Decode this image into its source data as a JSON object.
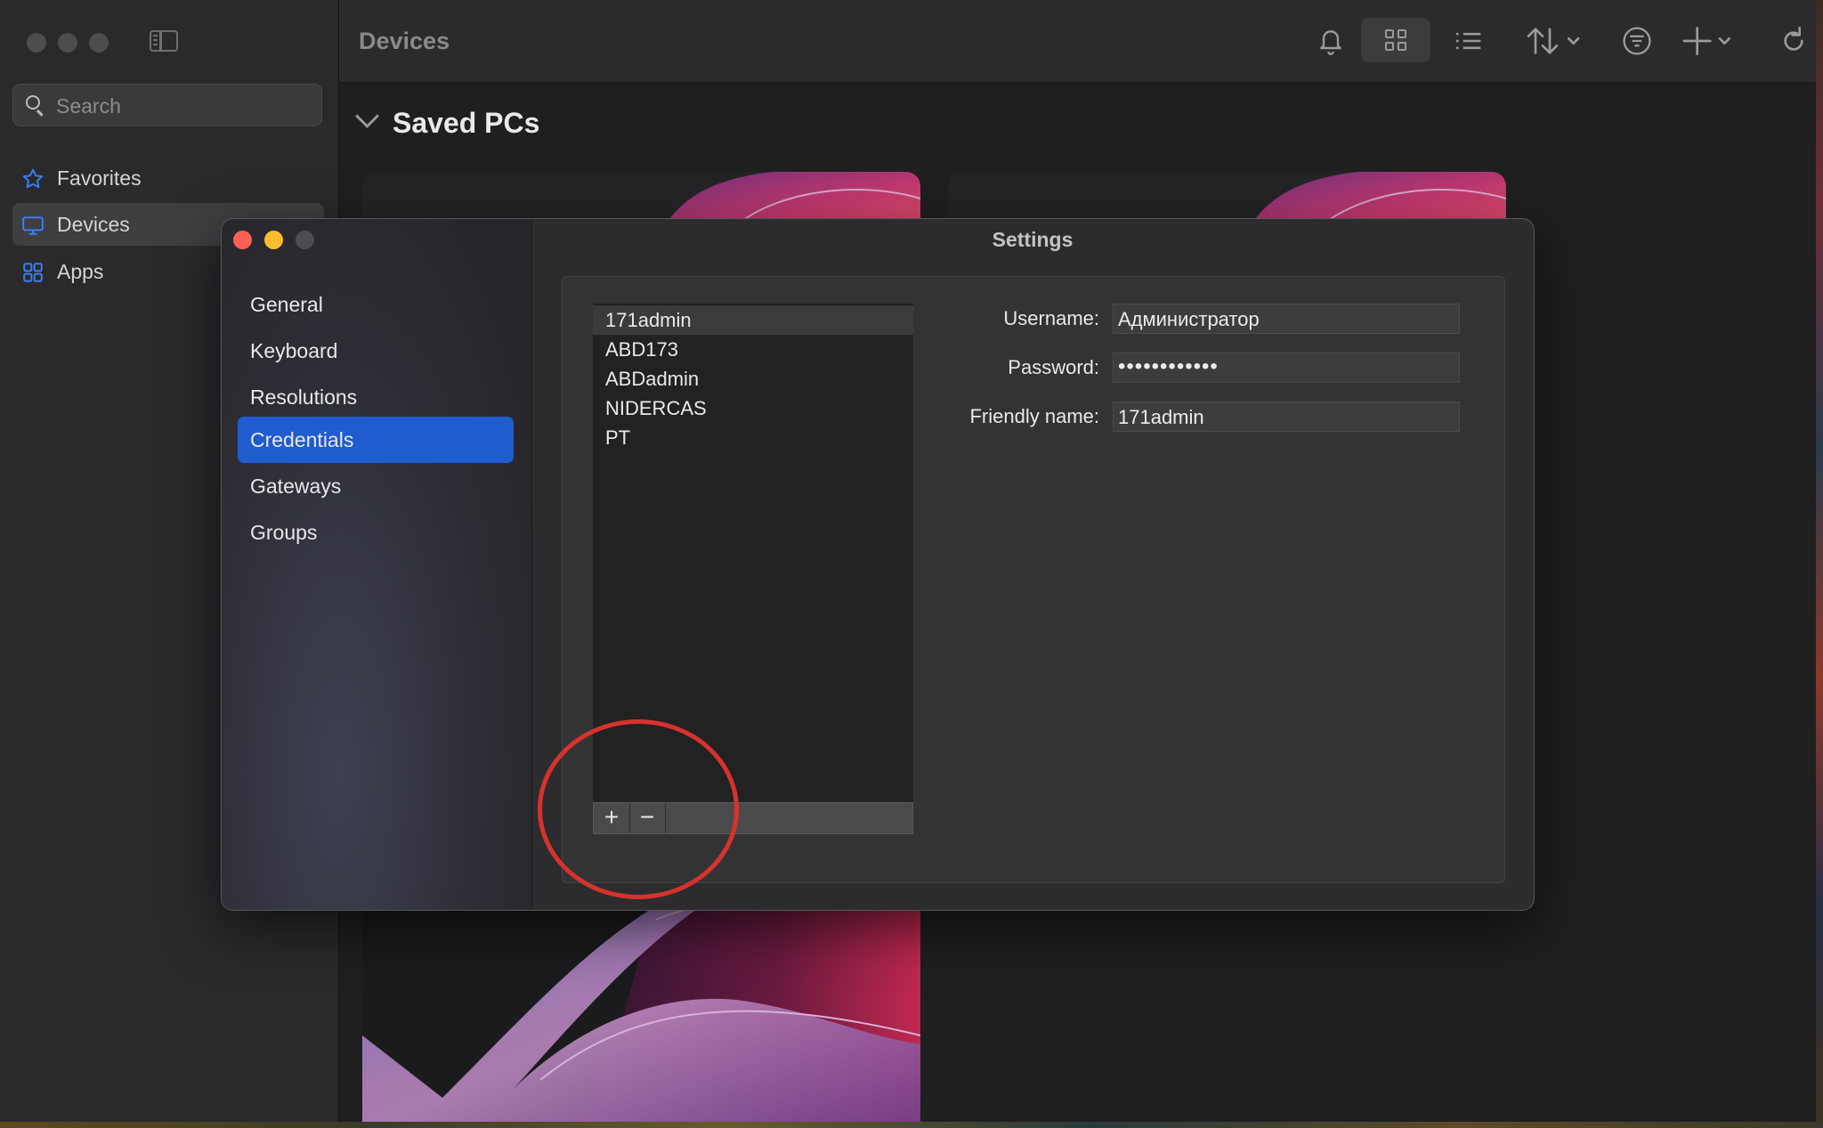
{
  "app": {
    "title": "Devices",
    "search": {
      "placeholder": "Search"
    },
    "sidebar": {
      "items": [
        {
          "label": "Favorites",
          "icon": "star-icon"
        },
        {
          "label": "Devices",
          "icon": "monitor-icon",
          "selected": true
        },
        {
          "label": "Apps",
          "icon": "apps-grid-icon"
        }
      ]
    },
    "toolbar": {
      "icons": [
        "bell-icon",
        "grid-view-icon",
        "list-view-icon",
        "sort-icon",
        "filter-icon",
        "add-icon",
        "refresh-icon"
      ]
    },
    "section": {
      "title": "Saved PCs",
      "expanded": true
    }
  },
  "settings": {
    "title": "Settings",
    "nav": [
      {
        "label": "General"
      },
      {
        "label": "Keyboard"
      },
      {
        "label": "Resolutions"
      },
      {
        "label": "Credentials",
        "selected": true
      },
      {
        "label": "Gateways"
      },
      {
        "label": "Groups"
      }
    ],
    "credentials": {
      "list": [
        "171admin",
        "ABD173",
        "ABDadmin",
        "NIDERCAS",
        "PT"
      ],
      "selected": "171admin",
      "add_symbol": "+",
      "remove_symbol": "−",
      "fields": {
        "username_label": "Username:",
        "username_value": "Администратор",
        "password_label": "Password:",
        "password_value": "••••••••••••",
        "friendly_label": "Friendly name:",
        "friendly_value": "171admin"
      }
    }
  },
  "colors": {
    "accent": "#1f5ccf",
    "close": "#fe5f57",
    "minimize": "#febc2e",
    "annotation": "#d8322c",
    "sidebar_icon": "#3b7ff3"
  }
}
